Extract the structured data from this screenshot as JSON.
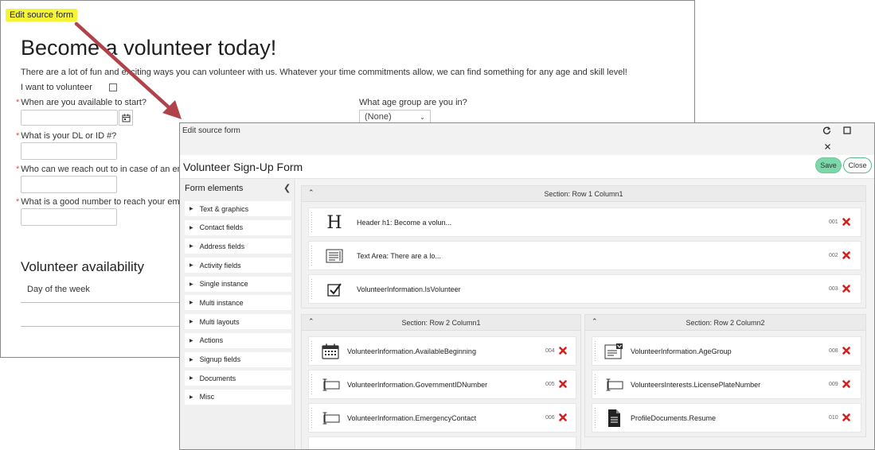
{
  "background_form": {
    "highlight_label": "Edit source form",
    "title": "Become a volunteer today!",
    "description": "There are a lot of fun and exciting ways you can volunteer with us. Whatever your time commitments allow, we can find something for any age and skill level!",
    "volunteer_checkbox_label": "I want to volunteer",
    "required_mark": "*",
    "fields": {
      "available_start": "When are you available to start?",
      "dl_id": "What is your DL or ID #?",
      "emergency_contact": "Who can we reach out to in case of an em",
      "emergency_number": "What is a good number to reach your em",
      "age_group": "What age group are you in?"
    },
    "age_group_value": "(None)",
    "availability_heading": "Volunteer availability",
    "day_of_week_column": "Day of the week"
  },
  "modal": {
    "window_title": "Edit source form",
    "form_title": "Volunteer Sign-Up Form",
    "save_label": "Save",
    "close_label": "Close",
    "sidebar": {
      "heading": "Form elements",
      "items": [
        "Text & graphics",
        "Contact fields",
        "Address fields",
        "Activity fields",
        "Single instance",
        "Multi instance",
        "Multi layouts",
        "Actions",
        "Signup fields",
        "Documents",
        "Misc"
      ]
    },
    "sections": [
      {
        "title": "Section: Row 1 Column1",
        "elements": [
          {
            "icon": "header-h-icon",
            "glyph": "H",
            "label": "Header h1: Become a volun...",
            "number": "001"
          },
          {
            "icon": "text-area-icon",
            "label": "Text Area: There are a lo...",
            "number": "002"
          },
          {
            "icon": "checkbox-icon",
            "label": "VolunteerInformation.IsVolunteer",
            "number": "003"
          }
        ]
      },
      {
        "title": "Section: Row 2 Column1",
        "elements": [
          {
            "icon": "calendar-icon",
            "label": "VolunteerInformation.AvailableBeginning",
            "number": "004"
          },
          {
            "icon": "text-input-icon",
            "label": "VolunteerInformation.GovernmentIDNumber",
            "number": "005"
          },
          {
            "icon": "text-input-icon",
            "label": "VolunteerInformation.EmergencyContact",
            "number": "006"
          }
        ]
      },
      {
        "title": "Section: Row 2 Column2",
        "elements": [
          {
            "icon": "dropdown-list-icon",
            "label": "VolunteerInformation.AgeGroup",
            "number": "008"
          },
          {
            "icon": "text-input-icon",
            "label": "VolunteersInterests.LicensePlateNumber",
            "number": "009"
          },
          {
            "icon": "document-icon",
            "label": "ProfileDocuments.Resume",
            "number": "010"
          }
        ]
      }
    ]
  },
  "colors": {
    "highlight": "#f5f535",
    "arrow": "#b0434a",
    "save_button": "#7ed7a9",
    "delete_x": "#d62020",
    "required": "#d9534f"
  }
}
